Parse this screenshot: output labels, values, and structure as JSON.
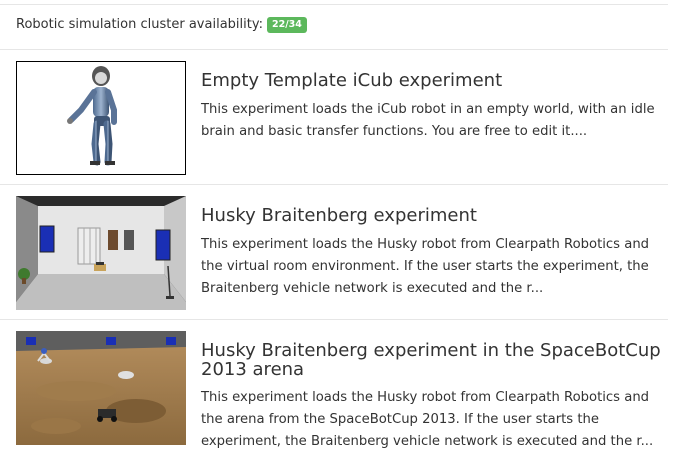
{
  "availability": {
    "label": "Robotic simulation cluster availability:",
    "badge": "22/34",
    "badge_color": "#5cb85c"
  },
  "experiments": [
    {
      "title": "Empty Template iCub experiment",
      "description": "This experiment loads the iCub robot in an empty world, with an idle brain and basic transfer functions. You are free to edit it....",
      "thumbnail": "icub-robot-thumbnail"
    },
    {
      "title": "Husky Braitenberg experiment",
      "description": "This experiment loads the Husky robot from Clearpath Robotics and the virtual room environment. If the user starts the experiment, the Braitenberg vehicle network is executed and the r...",
      "thumbnail": "virtual-room-thumbnail"
    },
    {
      "title": "Husky Braitenberg experiment in the SpaceBotCup 2013 arena",
      "description": "This experiment loads the Husky robot from Clearpath Robotics and the arena from the SpaceBotCup 2013. If the user starts the experiment, the Braitenberg vehicle network is executed and the r...",
      "thumbnail": "spacebotcup-arena-thumbnail"
    }
  ]
}
